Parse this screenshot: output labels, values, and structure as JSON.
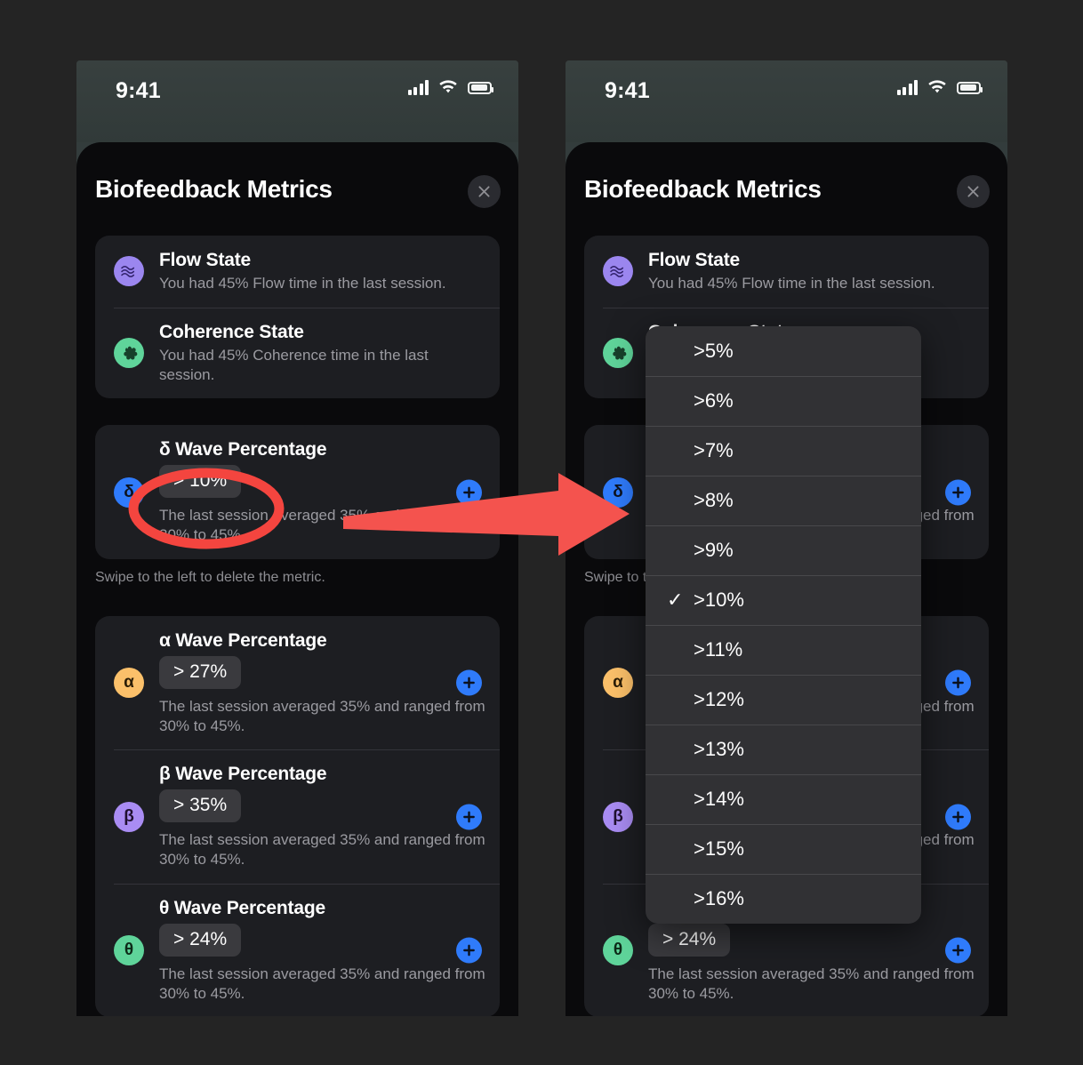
{
  "status_bar": {
    "time": "9:41",
    "signal_icon": "cellular-signal-icon",
    "wifi_icon": "wifi-icon",
    "battery_icon": "battery-icon"
  },
  "sheet": {
    "title": "Biofeedback Metrics",
    "close_icon": "close-icon"
  },
  "hint_text": "Swipe to the left to delete the metric.",
  "states": [
    {
      "icon": "waves-icon",
      "badge": "flow",
      "title": "Flow State",
      "subtitle": "You had 45% Flow time in the last session."
    },
    {
      "icon": "clover-icon",
      "badge": "coh",
      "title": "Coherence State",
      "subtitle": "You had 45% Coherence time in the last session."
    }
  ],
  "metrics": [
    {
      "symbol": "δ",
      "badge": "delta",
      "title": "δ Wave Percentage",
      "value": "> 10%",
      "subtitle": "The last session averaged 35% and ranged from 30% to 45%.",
      "add_icon": "plus-icon"
    },
    {
      "symbol": "α",
      "badge": "alpha",
      "title": "α Wave Percentage",
      "value": "> 27%",
      "subtitle": "The last session averaged 35% and ranged from 30% to 45%.",
      "add_icon": "plus-icon"
    },
    {
      "symbol": "β",
      "badge": "beta",
      "title": "β Wave Percentage",
      "value": "> 35%",
      "subtitle": "The last session averaged 35% and ranged from 30% to 45%.",
      "add_icon": "plus-icon"
    },
    {
      "symbol": "θ",
      "badge": "theta",
      "title": "θ Wave Percentage",
      "value": "> 24%",
      "subtitle": "The last session averaged 35% and ranged from 30% to 45%.",
      "add_icon": "plus-icon"
    }
  ],
  "dropdown": {
    "selected": ">10%",
    "check_icon": "checkmark-icon",
    "options": [
      ">5%",
      ">6%",
      ">7%",
      ">8%",
      ">9%",
      ">10%",
      ">11%",
      ">12%",
      ">13%",
      ">14%",
      ">15%",
      ">16%"
    ]
  },
  "annotation": {
    "circle_color": "#f4453f",
    "arrow_color": "#f4534e",
    "ellipse_label": "highlight-ellipse",
    "arrow_label": "pointer-arrow"
  },
  "colors": {
    "page_background": "#242424",
    "sheet_background": "#0a0a0c",
    "card_background": "#1d1e22",
    "pill_background": "#3a3a3e",
    "menu_background": "#313134",
    "accent_blue": "#2f7bfb",
    "status_bar": "#333c3c"
  }
}
